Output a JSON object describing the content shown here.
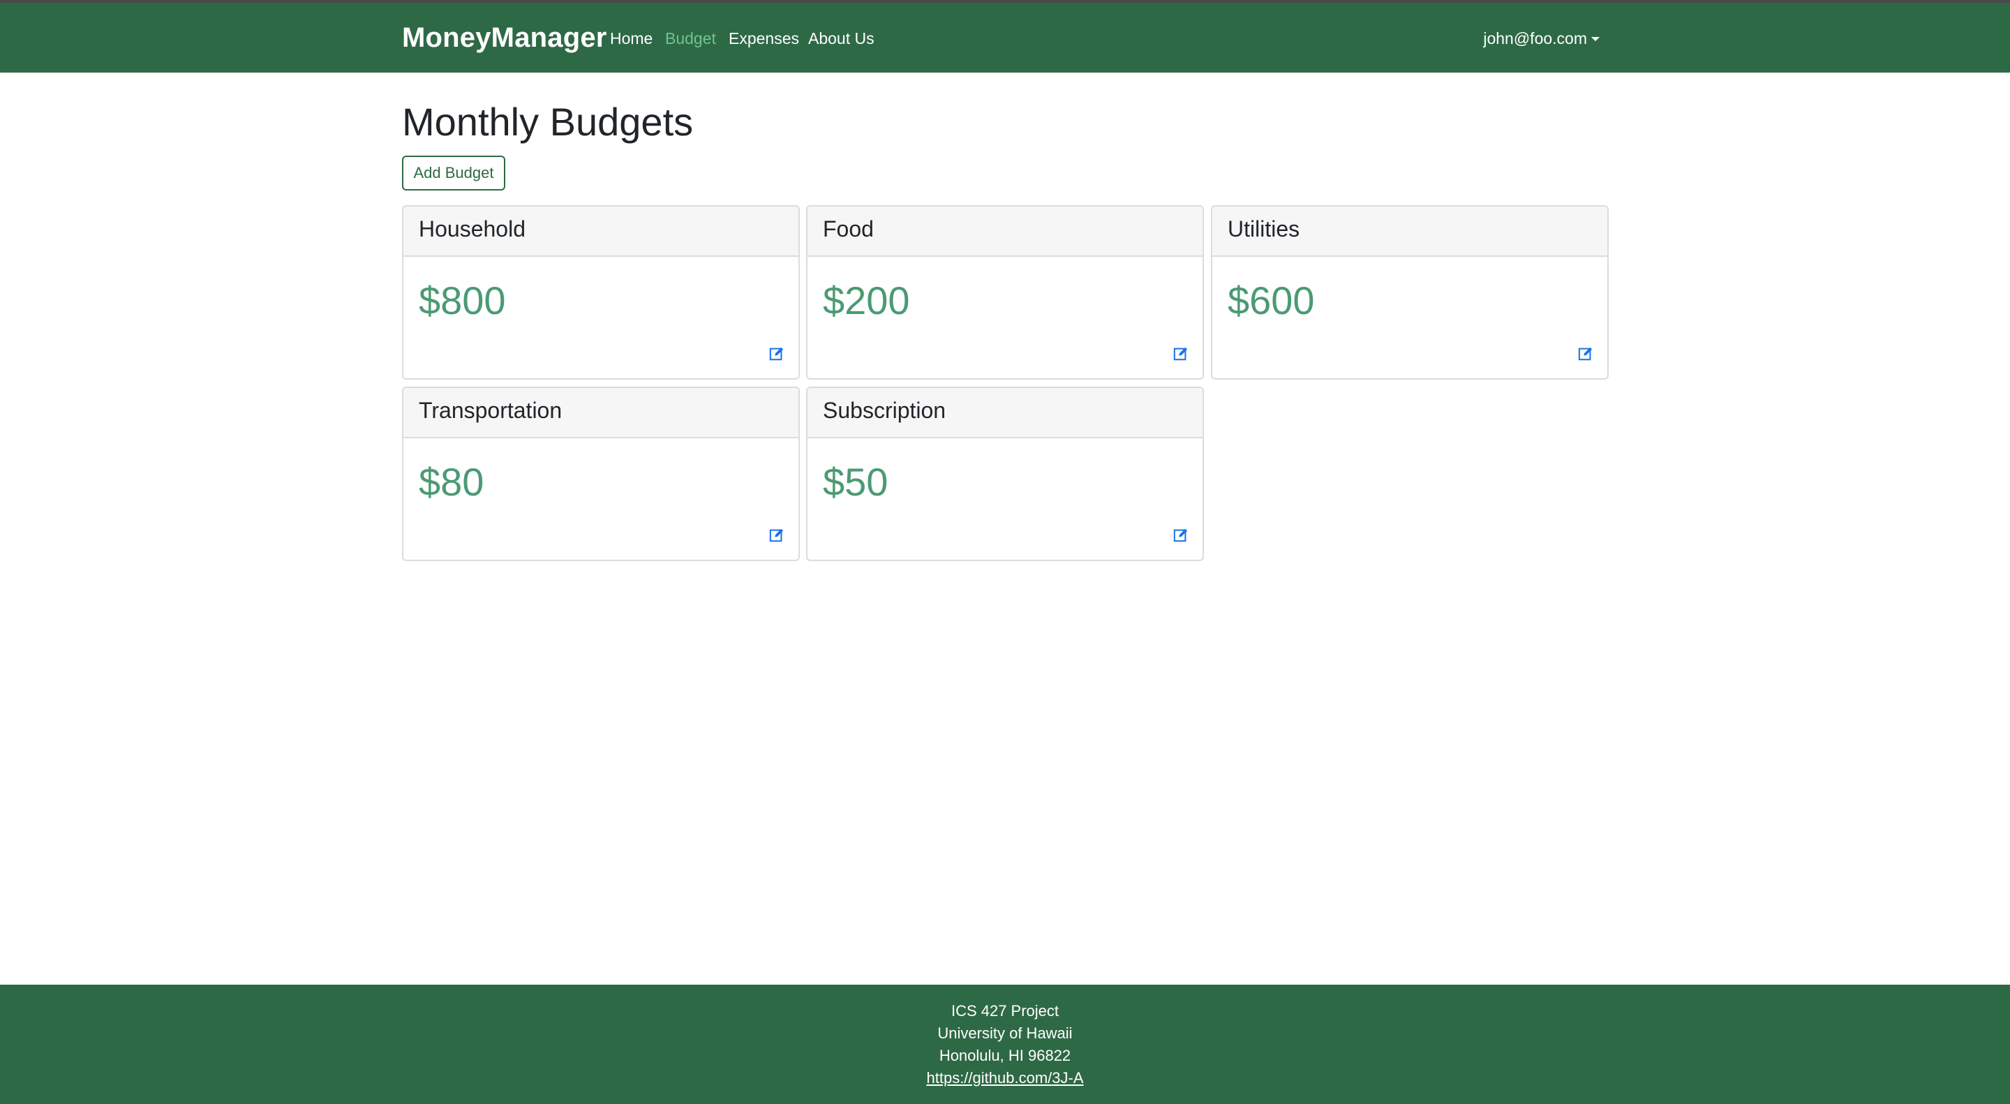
{
  "navbar": {
    "brand": "MoneyManager",
    "items": [
      {
        "label": "Home",
        "active": false
      },
      {
        "label": "Budget",
        "active": true
      },
      {
        "label": "Expenses",
        "active": false
      },
      {
        "label": "About Us",
        "active": false
      }
    ],
    "user": "john@foo.com",
    "user_icon": "caret-down-icon"
  },
  "main": {
    "title": "Monthly Budgets",
    "add_button": "Add Budget",
    "budgets": [
      {
        "name": "Household",
        "amount": "$800",
        "edit_icon": "edit-icon"
      },
      {
        "name": "Food",
        "amount": "$200",
        "edit_icon": "edit-icon"
      },
      {
        "name": "Utilities",
        "amount": "$600",
        "edit_icon": "edit-icon"
      },
      {
        "name": "Transportation",
        "amount": "$80",
        "edit_icon": "edit-icon"
      },
      {
        "name": "Subscription",
        "amount": "$50",
        "edit_icon": "edit-icon"
      }
    ]
  },
  "footer": {
    "line1": "ICS 427 Project",
    "line2": "University of Hawaii",
    "line3": "Honolulu, HI 96822",
    "link": "https://github.com/3J-A"
  },
  "colors": {
    "brand_green": "#2e6945",
    "active_nav": "#6fc393",
    "amount_green": "#4b9a73",
    "edit_icon_blue": "#1a73e8"
  }
}
